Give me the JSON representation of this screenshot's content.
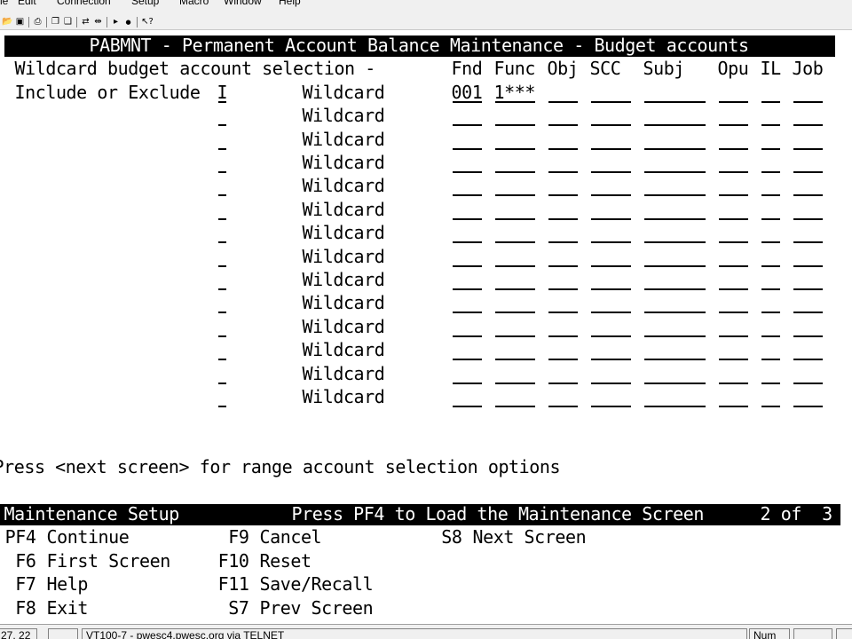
{
  "menu": {
    "items": [
      "File",
      "Edit",
      "Connection",
      "Setup",
      "Macro",
      "Window",
      "Help"
    ]
  },
  "toolbar": {
    "icons": [
      "open-folder-icon",
      "save-icon",
      "print-icon",
      "copy-icon",
      "paste-icon",
      "connect-icon",
      "disconnect-icon",
      "play-icon",
      "record-icon",
      "context-help-icon"
    ]
  },
  "screen": {
    "title": "PABMNT - Permanent Account Balance Maintenance - Budget accounts",
    "selection_label": "Wildcard budget account selection -",
    "columns": [
      "Fnd",
      "Func",
      "Obj",
      "SCC",
      "Subj",
      "Opu",
      "IL",
      "Job"
    ],
    "include_label": "Include or Exclude",
    "row_label": "Wildcard",
    "rows": [
      {
        "flag": "I",
        "fnd": "001",
        "func": "1***",
        "obj": "",
        "scc": "",
        "subj": "",
        "opu": "",
        "il": "",
        "job": ""
      },
      {
        "flag": "",
        "fnd": "",
        "func": "",
        "obj": "",
        "scc": "",
        "subj": "",
        "opu": "",
        "il": "",
        "job": ""
      },
      {
        "flag": "",
        "fnd": "",
        "func": "",
        "obj": "",
        "scc": "",
        "subj": "",
        "opu": "",
        "il": "",
        "job": ""
      },
      {
        "flag": "",
        "fnd": "",
        "func": "",
        "obj": "",
        "scc": "",
        "subj": "",
        "opu": "",
        "il": "",
        "job": ""
      },
      {
        "flag": "",
        "fnd": "",
        "func": "",
        "obj": "",
        "scc": "",
        "subj": "",
        "opu": "",
        "il": "",
        "job": ""
      },
      {
        "flag": "",
        "fnd": "",
        "func": "",
        "obj": "",
        "scc": "",
        "subj": "",
        "opu": "",
        "il": "",
        "job": ""
      },
      {
        "flag": "",
        "fnd": "",
        "func": "",
        "obj": "",
        "scc": "",
        "subj": "",
        "opu": "",
        "il": "",
        "job": ""
      },
      {
        "flag": "",
        "fnd": "",
        "func": "",
        "obj": "",
        "scc": "",
        "subj": "",
        "opu": "",
        "il": "",
        "job": ""
      },
      {
        "flag": "",
        "fnd": "",
        "func": "",
        "obj": "",
        "scc": "",
        "subj": "",
        "opu": "",
        "il": "",
        "job": ""
      },
      {
        "flag": "",
        "fnd": "",
        "func": "",
        "obj": "",
        "scc": "",
        "subj": "",
        "opu": "",
        "il": "",
        "job": ""
      },
      {
        "flag": "",
        "fnd": "",
        "func": "",
        "obj": "",
        "scc": "",
        "subj": "",
        "opu": "",
        "il": "",
        "job": ""
      },
      {
        "flag": "",
        "fnd": "",
        "func": "",
        "obj": "",
        "scc": "",
        "subj": "",
        "opu": "",
        "il": "",
        "job": ""
      },
      {
        "flag": "",
        "fnd": "",
        "func": "",
        "obj": "",
        "scc": "",
        "subj": "",
        "opu": "",
        "il": "",
        "job": ""
      },
      {
        "flag": "",
        "fnd": "",
        "func": "",
        "obj": "",
        "scc": "",
        "subj": "",
        "opu": "",
        "il": "",
        "job": ""
      }
    ],
    "next_screen_hint": "Press <next screen> for range account selection options",
    "footer_left": "Maintenance Setup",
    "footer_center": "Press PF4 to Load the Maintenance Screen",
    "footer_page": "2 of  3",
    "function_keys": [
      {
        "key": "PF4",
        "label": "Continue"
      },
      {
        "key": "F6",
        "label": "First Screen"
      },
      {
        "key": "F7",
        "label": "Help"
      },
      {
        "key": "F8",
        "label": "Exit"
      },
      {
        "key": "F9",
        "label": "Cancel"
      },
      {
        "key": "F10",
        "label": "Reset"
      },
      {
        "key": "F11",
        "label": "Save/Recall"
      },
      {
        "key": "S7",
        "label": "Prev Screen"
      },
      {
        "key": "S8",
        "label": "Next Screen"
      }
    ]
  },
  "status": {
    "cursor": "27, 22",
    "session": "VT100-7 - pwesc4.pwesc.org via TELNET",
    "num": "Num"
  }
}
